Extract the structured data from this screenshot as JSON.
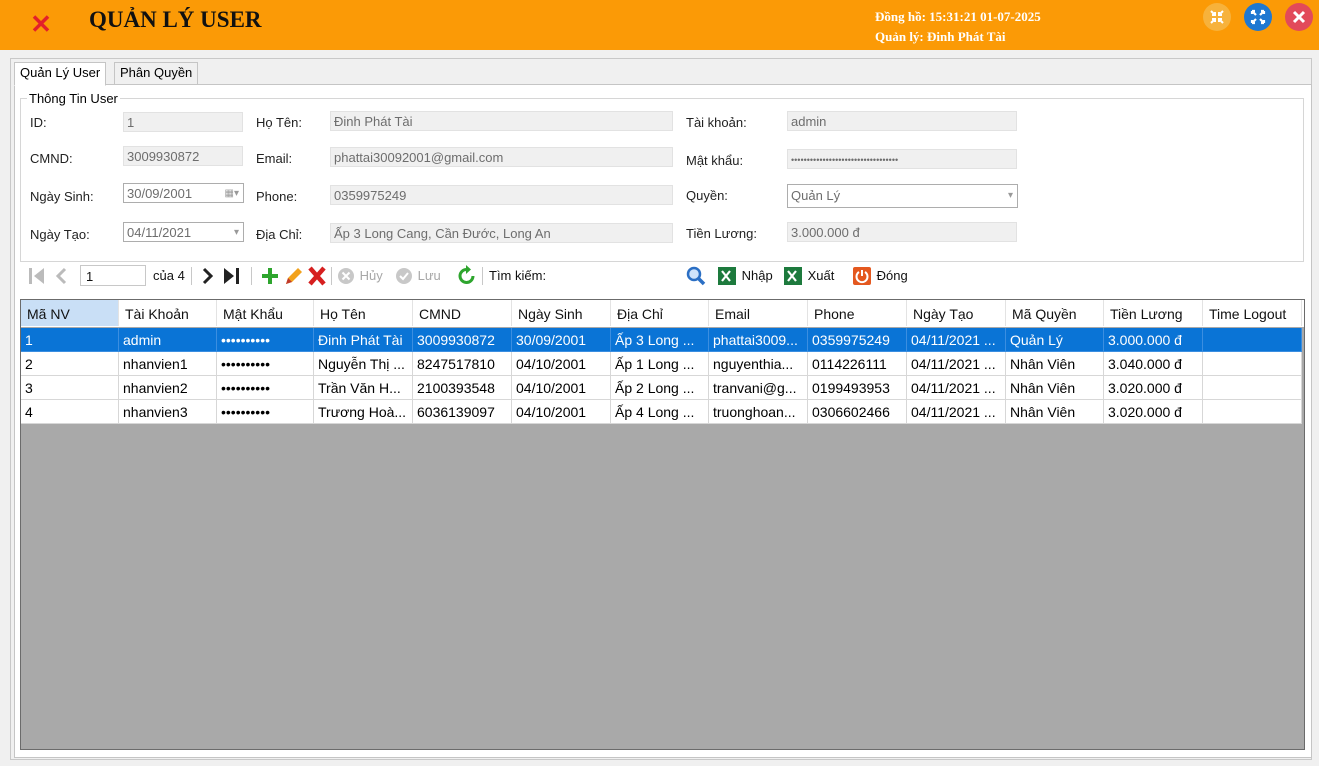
{
  "app": {
    "title": "QUẢN LÝ USER",
    "clock_line": "Đồng hồ: 15:31:21 01-07-2025",
    "manager_line": "Quản lý: Đinh Phát Tài"
  },
  "colors": {
    "header_bg": "#fb9a06",
    "selected_row": "#0a74d6",
    "grid_bg": "#a9a9a9"
  },
  "tabs": [
    {
      "label": "Quản Lý User",
      "active": true
    },
    {
      "label": "Phân Quyền",
      "active": false
    }
  ],
  "form": {
    "group_title": "Thông Tin User",
    "id": {
      "label": "ID:",
      "value": "1"
    },
    "cmnd": {
      "label": "CMND:",
      "value": "3009930872"
    },
    "birth": {
      "label": "Ngày Sinh:",
      "value": "30/09/2001"
    },
    "created": {
      "label": "Ngày Tạo:",
      "value": "04/11/2021"
    },
    "name": {
      "label": "Họ Tên:",
      "value": "Đinh Phát Tài"
    },
    "email": {
      "label": "Email:",
      "value": "phattai30092001@gmail.com"
    },
    "phone": {
      "label": "Phone:",
      "value": "0359975249"
    },
    "address": {
      "label": "Địa Chỉ:",
      "value": "Ấp 3 Long Cang, Cần Đước, Long An"
    },
    "account": {
      "label": "Tài khoản:",
      "value": "admin"
    },
    "password": {
      "label": "Mật khẩu:",
      "value": "••••••••••••••••••••••••••••••••••"
    },
    "role": {
      "label": "Quyền:",
      "value": "Quản Lý"
    },
    "salary": {
      "label": "Tiền Lương:",
      "value": "3.000.000 đ"
    }
  },
  "toolbar": {
    "position": "1",
    "of_count": "của 4",
    "cancel": "Hủy",
    "save": "Lưu",
    "search_label": "Tìm kiếm:",
    "search_value": "",
    "import": "Nhập",
    "export": "Xuất",
    "close": "Đóng"
  },
  "grid": {
    "columns": [
      "Mã NV",
      "Tài Khoản",
      "Mật Khẩu",
      "Họ Tên",
      "CMND",
      "Ngày Sinh",
      "Địa Chỉ",
      "Email",
      "Phone",
      "Ngày Tạo",
      "Mã Quyền",
      "Tiền Lương",
      "Time Logout"
    ],
    "rows": [
      [
        "1",
        "admin",
        "••••••••••",
        "Đinh Phát Tài",
        "3009930872",
        "30/09/2001",
        "Ấp 3 Long ...",
        "phattai3009...",
        "0359975249",
        "04/11/2021 ...",
        "Quản Lý",
        "3.000.000 đ",
        ""
      ],
      [
        "2",
        "nhanvien1",
        "••••••••••",
        "Nguyễn Thị ...",
        "8247517810",
        "04/10/2001",
        "Ấp 1 Long ...",
        "nguyenthia...",
        "0114226111",
        "04/11/2021 ...",
        "Nhân Viên",
        "3.040.000 đ",
        ""
      ],
      [
        "3",
        "nhanvien2",
        "••••••••••",
        "Trần Văn H...",
        "2100393548",
        "04/10/2001",
        "Ấp 2 Long ...",
        "tranvani@g...",
        "0199493953",
        "04/11/2021 ...",
        "Nhân Viên",
        "3.020.000 đ",
        ""
      ],
      [
        "4",
        "nhanvien3",
        "••••••••••",
        "Trương Hoà...",
        "6036139097",
        "04/10/2001",
        "Ấp 4 Long ...",
        "truonghoan...",
        "0306602466",
        "04/11/2021 ...",
        "Nhân Viên",
        "3.020.000 đ",
        ""
      ]
    ]
  }
}
